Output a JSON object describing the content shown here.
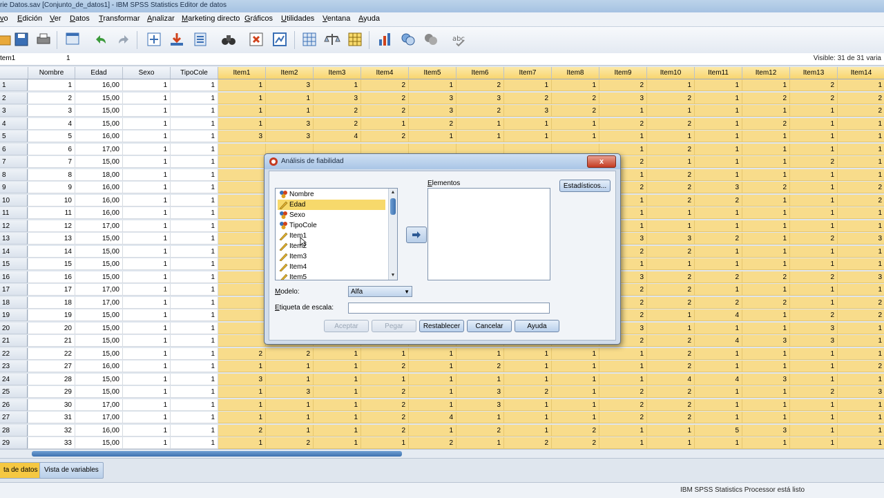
{
  "window": {
    "title": "rie Datos.sav [Conjunto_de_datos1] - IBM SPSS Statistics Editor de datos"
  },
  "menu": [
    "vo",
    "Edición",
    "Ver",
    "Datos",
    "Transformar",
    "Analizar",
    "Marketing directo",
    "Gráficos",
    "Utilidades",
    "Ventana",
    "Ayuda"
  ],
  "cellbar": {
    "ref": "tem1",
    "value": "1",
    "visible": "Visible: 31 de 31 varia"
  },
  "columns": [
    "Nombre",
    "Edad",
    "Sexo",
    "TipoCole",
    "Item1",
    "Item2",
    "Item3",
    "Item4",
    "Item5",
    "Item6",
    "Item7",
    "Item8",
    "Item9",
    "Item10",
    "Item11",
    "Item12",
    "Item13",
    "Item14"
  ],
  "rows": [
    {
      "n": "1",
      "v": [
        "1",
        "16,00",
        "1",
        "1",
        "1",
        "3",
        "1",
        "2",
        "1",
        "2",
        "1",
        "1",
        "2",
        "1",
        "1",
        "1",
        "2",
        "1"
      ]
    },
    {
      "n": "2",
      "v": [
        "2",
        "15,00",
        "1",
        "1",
        "1",
        "1",
        "3",
        "2",
        "3",
        "3",
        "2",
        "2",
        "3",
        "2",
        "1",
        "2",
        "2",
        "2"
      ]
    },
    {
      "n": "3",
      "v": [
        "3",
        "15,00",
        "1",
        "1",
        "1",
        "1",
        "2",
        "2",
        "3",
        "2",
        "3",
        "2",
        "1",
        "1",
        "1",
        "1",
        "1",
        "2"
      ]
    },
    {
      "n": "4",
      "v": [
        "4",
        "15,00",
        "1",
        "1",
        "1",
        "3",
        "2",
        "1",
        "2",
        "1",
        "1",
        "1",
        "2",
        "2",
        "1",
        "2",
        "1",
        "1"
      ]
    },
    {
      "n": "5",
      "v": [
        "5",
        "16,00",
        "1",
        "1",
        "3",
        "3",
        "4",
        "2",
        "1",
        "1",
        "1",
        "1",
        "1",
        "1",
        "1",
        "1",
        "1",
        "1"
      ]
    },
    {
      "n": "6",
      "v": [
        "6",
        "17,00",
        "1",
        "1",
        "",
        "",
        "",
        "",
        "",
        "",
        "",
        "",
        "1",
        "2",
        "1",
        "1",
        "1",
        "1"
      ]
    },
    {
      "n": "7",
      "v": [
        "7",
        "15,00",
        "1",
        "1",
        "",
        "",
        "",
        "",
        "",
        "",
        "",
        "",
        "2",
        "1",
        "1",
        "1",
        "2",
        "1"
      ]
    },
    {
      "n": "8",
      "v": [
        "8",
        "18,00",
        "1",
        "1",
        "",
        "",
        "",
        "",
        "",
        "",
        "",
        "",
        "1",
        "2",
        "1",
        "1",
        "1",
        "1"
      ]
    },
    {
      "n": "9",
      "v": [
        "9",
        "16,00",
        "1",
        "1",
        "",
        "",
        "",
        "",
        "",
        "",
        "",
        "",
        "2",
        "2",
        "3",
        "2",
        "1",
        "2"
      ]
    },
    {
      "n": "10",
      "v": [
        "10",
        "16,00",
        "1",
        "1",
        "",
        "",
        "",
        "",
        "",
        "",
        "",
        "",
        "1",
        "2",
        "2",
        "1",
        "1",
        "2"
      ]
    },
    {
      "n": "11",
      "v": [
        "11",
        "16,00",
        "1",
        "1",
        "",
        "",
        "",
        "",
        "",
        "",
        "",
        "",
        "1",
        "1",
        "1",
        "1",
        "1",
        "1"
      ]
    },
    {
      "n": "12",
      "v": [
        "12",
        "17,00",
        "1",
        "1",
        "",
        "",
        "",
        "",
        "",
        "",
        "",
        "",
        "1",
        "1",
        "1",
        "1",
        "1",
        "1"
      ]
    },
    {
      "n": "13",
      "v": [
        "13",
        "15,00",
        "1",
        "1",
        "",
        "",
        "",
        "",
        "",
        "",
        "",
        "",
        "3",
        "3",
        "2",
        "1",
        "2",
        "3"
      ]
    },
    {
      "n": "14",
      "v": [
        "14",
        "15,00",
        "1",
        "1",
        "",
        "",
        "",
        "",
        "",
        "",
        "",
        "",
        "2",
        "2",
        "1",
        "1",
        "1",
        "1"
      ]
    },
    {
      "n": "15",
      "v": [
        "15",
        "15,00",
        "1",
        "1",
        "",
        "",
        "",
        "",
        "",
        "",
        "",
        "",
        "1",
        "1",
        "1",
        "1",
        "1",
        "1"
      ]
    },
    {
      "n": "16",
      "v": [
        "16",
        "15,00",
        "1",
        "1",
        "",
        "",
        "",
        "",
        "",
        "",
        "",
        "",
        "3",
        "2",
        "2",
        "2",
        "2",
        "3"
      ]
    },
    {
      "n": "17",
      "v": [
        "17",
        "17,00",
        "1",
        "1",
        "",
        "",
        "",
        "",
        "",
        "",
        "",
        "",
        "2",
        "2",
        "1",
        "1",
        "1",
        "1"
      ]
    },
    {
      "n": "18",
      "v": [
        "18",
        "17,00",
        "1",
        "1",
        "",
        "",
        "",
        "",
        "",
        "",
        "",
        "",
        "2",
        "2",
        "2",
        "2",
        "1",
        "2"
      ]
    },
    {
      "n": "19",
      "v": [
        "19",
        "15,00",
        "1",
        "1",
        "",
        "",
        "",
        "",
        "",
        "",
        "",
        "",
        "2",
        "1",
        "4",
        "1",
        "2",
        "2"
      ]
    },
    {
      "n": "20",
      "v": [
        "20",
        "15,00",
        "1",
        "1",
        "",
        "",
        "",
        "",
        "",
        "",
        "",
        "",
        "3",
        "1",
        "1",
        "1",
        "3",
        "1"
      ]
    },
    {
      "n": "21",
      "v": [
        "21",
        "15,00",
        "1",
        "1",
        "",
        "",
        "",
        "",
        "",
        "",
        "",
        "",
        "2",
        "2",
        "4",
        "3",
        "3",
        "1"
      ]
    },
    {
      "n": "22",
      "v": [
        "22",
        "15,00",
        "1",
        "1",
        "2",
        "2",
        "1",
        "1",
        "1",
        "1",
        "1",
        "1",
        "1",
        "2",
        "1",
        "1",
        "1",
        "1"
      ]
    },
    {
      "n": "23",
      "v": [
        "27",
        "16,00",
        "1",
        "1",
        "1",
        "1",
        "1",
        "2",
        "1",
        "2",
        "1",
        "1",
        "1",
        "2",
        "1",
        "1",
        "1",
        "2"
      ]
    },
    {
      "n": "24",
      "v": [
        "28",
        "15,00",
        "1",
        "1",
        "3",
        "1",
        "1",
        "1",
        "1",
        "1",
        "1",
        "1",
        "1",
        "4",
        "4",
        "3",
        "1",
        "1"
      ]
    },
    {
      "n": "25",
      "v": [
        "29",
        "15,00",
        "1",
        "1",
        "1",
        "3",
        "1",
        "2",
        "1",
        "3",
        "2",
        "1",
        "2",
        "2",
        "1",
        "1",
        "2",
        "3"
      ]
    },
    {
      "n": "26",
      "v": [
        "30",
        "17,00",
        "1",
        "1",
        "1",
        "1",
        "1",
        "2",
        "1",
        "3",
        "1",
        "1",
        "2",
        "2",
        "1",
        "1",
        "1",
        "1"
      ]
    },
    {
      "n": "27",
      "v": [
        "31",
        "17,00",
        "1",
        "1",
        "1",
        "1",
        "1",
        "2",
        "4",
        "1",
        "1",
        "1",
        "2",
        "2",
        "1",
        "1",
        "1",
        "1"
      ]
    },
    {
      "n": "28",
      "v": [
        "32",
        "16,00",
        "1",
        "1",
        "2",
        "1",
        "1",
        "2",
        "1",
        "2",
        "1",
        "2",
        "1",
        "1",
        "5",
        "3",
        "1",
        "1"
      ]
    },
    {
      "n": "29",
      "v": [
        "33",
        "15,00",
        "1",
        "1",
        "1",
        "2",
        "1",
        "1",
        "2",
        "1",
        "2",
        "2",
        "1",
        "1",
        "1",
        "1",
        "1",
        "1"
      ]
    }
  ],
  "tabs": {
    "data_view": "ta de datos",
    "var_view": "Vista de variables"
  },
  "status": "IBM SPSS Statistics Processor está listo",
  "dialog": {
    "title": "Análisis de fiabilidad",
    "close": "x",
    "variables": [
      {
        "label": "Nombre",
        "icon": "nominal-icon"
      },
      {
        "label": "Edad",
        "icon": "scale-icon"
      },
      {
        "label": "Sexo",
        "icon": "nominal-icon"
      },
      {
        "label": "TipoCole",
        "icon": "nominal-icon"
      },
      {
        "label": "Item1",
        "icon": "scale-icon"
      },
      {
        "label": "Item2",
        "icon": "scale-icon"
      },
      {
        "label": "Item3",
        "icon": "scale-icon"
      },
      {
        "label": "Item4",
        "icon": "scale-icon"
      },
      {
        "label": "Item5",
        "icon": "scale-icon"
      }
    ],
    "elements_label": "Elementos",
    "statistics_button": "Estadísticos...",
    "model_label": "Modelo:",
    "model_value": "Alfa",
    "scale_label_text": "Etiqueta de escala:",
    "scale_label_value": "",
    "buttons": {
      "ok": "Aceptar",
      "paste": "Pegar",
      "reset": "Restablecer",
      "cancel": "Cancelar",
      "help": "Ayuda"
    }
  },
  "colors": {
    "item_column": "#f8dc8b",
    "selected": "#f7d96b",
    "accent": "#3e72b0"
  }
}
